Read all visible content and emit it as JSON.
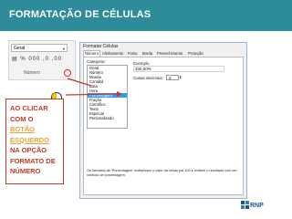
{
  "slide": {
    "title": "FORMATAÇÃO DE CÉLULAS",
    "logo_text": "RNP"
  },
  "ribbon": {
    "format_value": "Geral",
    "icons_text": "▤ % 000 ,0 ,00",
    "group_label": "Número"
  },
  "dialog": {
    "title": "Formatar Células",
    "tabs": [
      "Número",
      "Alinhamento",
      "Fonte",
      "Borda",
      "Preenchimento",
      "Proteção"
    ],
    "category_label": "Categoria:",
    "categories": [
      "Geral",
      "Número",
      "Moeda",
      "Contábil",
      "Data",
      "Hora",
      "Porcentagem",
      "Fração",
      "Científico",
      "Texto",
      "Especial",
      "Personalizado"
    ],
    "selected_category": "Porcentagem",
    "example_label": "Exemplo",
    "example_value": "330,00%",
    "decimal_label": "Casas decimais:",
    "decimal_value": "2",
    "description": "Os formatos de 'Porcentagem' multiplicam o valor da célula por 100 e exibem o resultado com um símbolo de porcentagem."
  },
  "callout": {
    "line1": "AO CLICAR",
    "line2": "COM O",
    "line3": "BOTÃO",
    "line4": "ESQUERDO",
    "line5": "NA OPÇÃO",
    "line6": "FORMATO DE",
    "line7": "NÚMERO"
  },
  "colors": {
    "header": "#2e8b99",
    "callout": "#c0392b",
    "highlight": "#e8a33a",
    "selection": "#3399ff"
  }
}
